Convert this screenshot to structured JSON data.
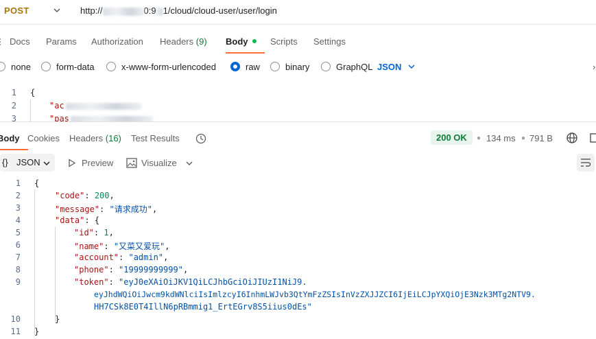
{
  "request": {
    "method": "POST",
    "url_prefix": "http://",
    "url_mid": "0:9",
    "url_suffix": "1/cloud/cloud-user/user/login"
  },
  "request_tabs": {
    "docs": "Docs",
    "params": "Params",
    "authorization": "Authorization",
    "headers": "Headers",
    "headers_count": "(9)",
    "body": "Body",
    "scripts": "Scripts",
    "settings": "Settings"
  },
  "body_types": {
    "none": "none",
    "form_data": "form-data",
    "urlencoded": "x-www-form-urlencoded",
    "raw": "raw",
    "binary": "binary",
    "graphql": "GraphQL",
    "format": "JSON"
  },
  "request_body": {
    "lines": [
      "1",
      "2",
      "3"
    ],
    "line1": "{",
    "line2": "\"ac",
    "line3": "\"pas"
  },
  "response_tabs": {
    "body": "Body",
    "cookies": "Cookies",
    "headers": "Headers",
    "headers_count": "(16)",
    "test_results": "Test Results"
  },
  "response_meta": {
    "status": "200 OK",
    "time": "134 ms",
    "size": "791 B"
  },
  "response_toolbar": {
    "format": "JSON",
    "preview": "Preview",
    "visualize": "Visualize"
  },
  "response_body": {
    "line_numbers": [
      "1",
      "2",
      "3",
      "4",
      "5",
      "6",
      "7",
      "8",
      "9",
      "",
      "",
      "10",
      "11"
    ],
    "code_key": "\"code\"",
    "code_val": "200",
    "message_key": "\"message\"",
    "message_val": "\"请求成功\"",
    "data_key": "\"data\"",
    "id_key": "\"id\"",
    "id_val": "1",
    "name_key": "\"name\"",
    "name_val": "\"又菜又爱玩\"",
    "account_key": "\"account\"",
    "account_val": "\"admin\"",
    "phone_key": "\"phone\"",
    "phone_val": "\"19999999999\"",
    "token_key": "\"token\"",
    "token_line1": "\"eyJ0eXAiOiJKV1QiLCJhbGciOiJIUzI1NiJ9.",
    "token_line2": "eyJhdWQiOiJwcm9kdWNlciIsImlzcyI6InhmLWJvb3QtYmFzZSIsInVzZXJJZCI6IjEiLCJpYXQiOjE3Nzk3MTg2NTV9.",
    "token_line3": "HH7CSk8E0T4IllN6pRBmmig1_ErtEGrv8S5iius0dEs\""
  },
  "colors": {
    "accent": "#ff6c37",
    "method": "#a8760a",
    "link_blue": "#0265d2",
    "status_green": "#0f7a3a"
  }
}
